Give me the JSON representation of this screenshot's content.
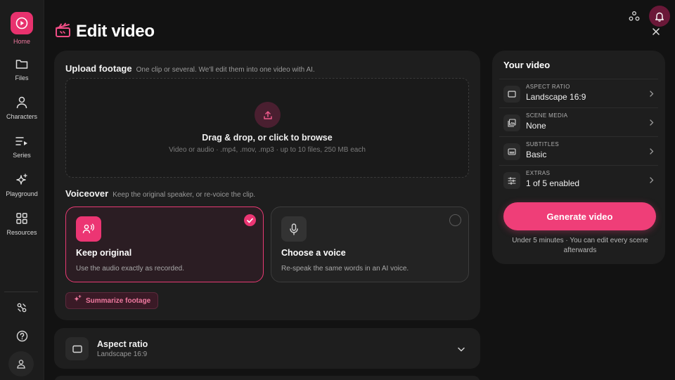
{
  "sidebar": {
    "items": [
      {
        "label": "Home",
        "icon": "home-icon"
      },
      {
        "label": "Files",
        "icon": "folder-icon"
      },
      {
        "label": "Characters",
        "icon": "person-icon"
      },
      {
        "label": "Series",
        "icon": "series-icon"
      },
      {
        "label": "Playground",
        "icon": "sparkles-icon"
      },
      {
        "label": "Resources",
        "icon": "grid-icon"
      }
    ],
    "bottom_icons": [
      "integrations-icon",
      "help-icon",
      "account-icon"
    ]
  },
  "header": {
    "title": "Edit video"
  },
  "upload": {
    "title": "Upload footage",
    "subtitle": "One clip or several. We'll edit them into one video with AI.",
    "drop_title": "Drag & drop, or click to browse",
    "drop_subtitle": "Video or audio · .mp4, .mov, .mp3 · up to 10 files, 250 MB each"
  },
  "voiceover": {
    "title": "Voiceover",
    "subtitle": "Keep the original speaker, or re-voice the clip.",
    "options": [
      {
        "title": "Keep original",
        "desc": "Use the audio exactly as recorded.",
        "selected": true
      },
      {
        "title": "Choose a voice",
        "desc": "Re-speak the same words in an AI voice.",
        "selected": false
      }
    ],
    "summarize_label": "Summarize footage"
  },
  "aspect_accordion": {
    "title": "Aspect ratio",
    "value": "Landscape 16:9"
  },
  "your_video": {
    "title": "Your video",
    "rows": [
      {
        "key": "ASPECT RATIO",
        "value": "Landscape 16:9"
      },
      {
        "key": "SCENE MEDIA",
        "value": "None"
      },
      {
        "key": "SUBTITLES",
        "value": "Basic"
      },
      {
        "key": "EXTRAS",
        "value": "1 of 5 enabled"
      }
    ],
    "generate_label": "Generate video",
    "note": "Under 5 minutes · You can edit every scene afterwards"
  },
  "colors": {
    "accent": "#ef3e78",
    "background": "#121212",
    "card": "#1e1e1e"
  }
}
